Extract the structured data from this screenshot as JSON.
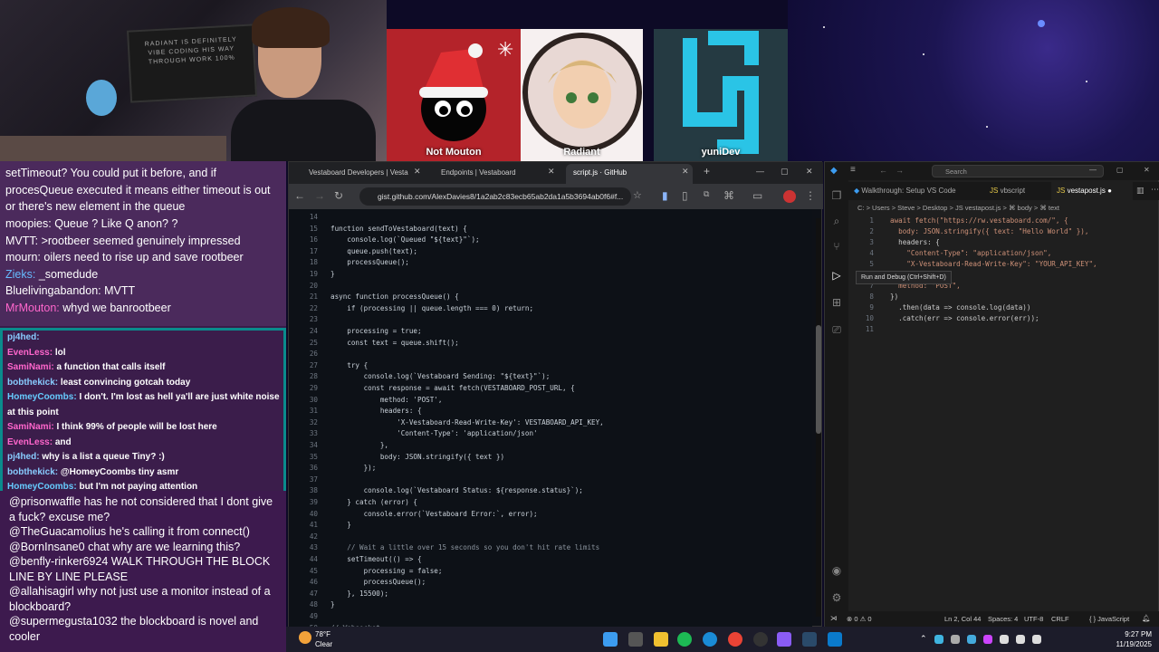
{
  "webcam": {
    "panel_text": "RADIANT IS DEFINITELY VIBE CODING HIS WAY THROUGH WORK 100%"
  },
  "guests": [
    {
      "name": "Not Mouton"
    },
    {
      "name": "Radiant"
    },
    {
      "name": "yuniDev"
    }
  ],
  "chat_top": [
    {
      "user": "",
      "text": "setTimeout? You could put it before, and if procesQueue executed it means either timeout is out or there's new element in the queue"
    },
    {
      "user": "moopies:",
      "text": "Queue ? Like Q anon? ?"
    },
    {
      "user": "MVTT:",
      "text": ">rootbeer seemed genuinely impressed"
    },
    {
      "user": "mourn:",
      "text": "oilers need to rise up and save rootbeer"
    },
    {
      "user": "Zieks:",
      "text": "_somedude"
    },
    {
      "user": "Bluelivingabandon:",
      "text": "MVTT"
    },
    {
      "user": "MrMouton:",
      "text": "whyd we banrootbeer"
    }
  ],
  "chat_mid": [
    {
      "user": "pj4hed:",
      "text": ""
    },
    {
      "user": "EvenLess:",
      "text": "lol"
    },
    {
      "user": "SamiNami:",
      "text": "a function that calls itself"
    },
    {
      "user": "bobthekick:",
      "text": "least convincing gotcah today"
    },
    {
      "user": "HomeyCoombs:",
      "text": "I don't. I'm lost as hell ya'll are just white noise at this point"
    },
    {
      "user": "SamiNami:",
      "text": "I think 99% of people will be lost here"
    },
    {
      "user": "EvenLess:",
      "text": "and"
    },
    {
      "user": "pj4hed:",
      "text": "why is a list a queue Tiny? :)"
    },
    {
      "user": "bobthekick:",
      "text": "@HomeyCoombs tiny asmr"
    },
    {
      "user": "HomeyCoombs:",
      "text": "but I'm not paying attention"
    }
  ],
  "chat_bottom": [
    {
      "user": "@prisonwaffle",
      "text": "has he not considered that I dont give a fuck? excuse me?"
    },
    {
      "user": "@TheGuacamolius",
      "text": "he's calling it from connect()"
    },
    {
      "user": "@BornInsane0",
      "text": "chat why are we learning this?"
    },
    {
      "user": "@benfly-rinker6924",
      "text": "WALK THROUGH THE BLOCK LINE BY LINE PLEASE"
    },
    {
      "user": "@allahisagirl",
      "text": "why not just use a monitor instead of a blockboard?"
    },
    {
      "user": "@supermegusta1032",
      "text": "the blockboard is novel and cooler"
    }
  ],
  "browser": {
    "tabs": [
      "Vestaboard Developers | Vesta",
      "Endpoints | Vestaboard",
      "script.js · GitHub"
    ],
    "url": "gist.github.com/AlexDavies8/1a2ab2c83ecb65ab2da1a5b3694ab0f6#f...",
    "code_lines": [
      {
        "n": "14",
        "t": ""
      },
      {
        "n": "15",
        "t": "function sendToVestaboard(text) {"
      },
      {
        "n": "16",
        "t": "    console.log(`Queued \"${text}\"`);"
      },
      {
        "n": "17",
        "t": "    queue.push(text);"
      },
      {
        "n": "18",
        "t": "    processQueue();"
      },
      {
        "n": "19",
        "t": "}"
      },
      {
        "n": "20",
        "t": ""
      },
      {
        "n": "21",
        "t": "async function processQueue() {"
      },
      {
        "n": "22",
        "t": "    if (processing || queue.length === 0) return;"
      },
      {
        "n": "23",
        "t": ""
      },
      {
        "n": "24",
        "t": "    processing = true;"
      },
      {
        "n": "25",
        "t": "    const text = queue.shift();"
      },
      {
        "n": "26",
        "t": ""
      },
      {
        "n": "27",
        "t": "    try {"
      },
      {
        "n": "28",
        "t": "        console.log(`Vestaboard Sending: \"${text}\"`);"
      },
      {
        "n": "29",
        "t": "        const response = await fetch(VESTABOARD_POST_URL, {"
      },
      {
        "n": "30",
        "t": "            method: 'POST',"
      },
      {
        "n": "31",
        "t": "            headers: {"
      },
      {
        "n": "32",
        "t": "                'X-Vestaboard-Read-Write-Key': VESTABOARD_API_KEY,"
      },
      {
        "n": "33",
        "t": "                'Content-Type': 'application/json'"
      },
      {
        "n": "34",
        "t": "            },"
      },
      {
        "n": "35",
        "t": "            body: JSON.stringify({ text })"
      },
      {
        "n": "36",
        "t": "        });"
      },
      {
        "n": "37",
        "t": ""
      },
      {
        "n": "38",
        "t": "        console.log(`Vestaboard Status: ${response.status}`);"
      },
      {
        "n": "39",
        "t": "    } catch (error) {"
      },
      {
        "n": "40",
        "t": "        console.error(`Vestaboard Error:`, error);"
      },
      {
        "n": "41",
        "t": "    }"
      },
      {
        "n": "42",
        "t": ""
      },
      {
        "n": "43",
        "t": "    // Wait a little over 15 seconds so you don't hit rate limits"
      },
      {
        "n": "44",
        "t": "    setTimeout(() => {"
      },
      {
        "n": "45",
        "t": "        processing = false;"
      },
      {
        "n": "46",
        "t": "        processQueue();"
      },
      {
        "n": "47",
        "t": "    }, 15500);"
      },
      {
        "n": "48",
        "t": "}"
      },
      {
        "n": "49",
        "t": ""
      },
      {
        "n": "50",
        "t": "// Websocket"
      }
    ]
  },
  "vscode": {
    "search": "Search",
    "tabs": [
      "Walkthrough: Setup VS Code",
      "vbscript",
      "vestapost.js"
    ],
    "breadcrumb": "C: > Users > Steve > Desktop > JS vestapost.js > ⌘ body > ⌘ text",
    "tooltip": "Run and Debug (Ctrl+Shift+D)",
    "lines": [
      {
        "n": "1",
        "t": "await fetch(\"https://rw.vestaboard.com/\", {"
      },
      {
        "n": "2",
        "t": "  body: JSON.stringify({ text: \"Hello World\" }),"
      },
      {
        "n": "3",
        "t": "  headers: {"
      },
      {
        "n": "4",
        "t": "    \"Content-Type\": \"application/json\","
      },
      {
        "n": "5",
        "t": "    \"X-Vestaboard-Read-Write-Key\": \"YOUR_API_KEY\","
      },
      {
        "n": "6",
        "t": "  },"
      },
      {
        "n": "7",
        "t": "  method: \"POST\","
      },
      {
        "n": "8",
        "t": "})"
      },
      {
        "n": "9",
        "t": "  .then(data => console.log(data))"
      },
      {
        "n": "10",
        "t": "  .catch(err => console.error(err));"
      },
      {
        "n": "11",
        "t": ""
      }
    ],
    "status": {
      "errors": "⊗ 0 ⚠ 0",
      "position": "Ln 2, Col 44",
      "spaces": "Spaces: 4",
      "encoding": "UTF-8",
      "eol": "CRLF",
      "language": "{ } JavaScript"
    }
  },
  "taskbar": {
    "temp": "78°F",
    "weather": "Clear",
    "time": "9:27 PM",
    "date": "11/19/2025"
  }
}
